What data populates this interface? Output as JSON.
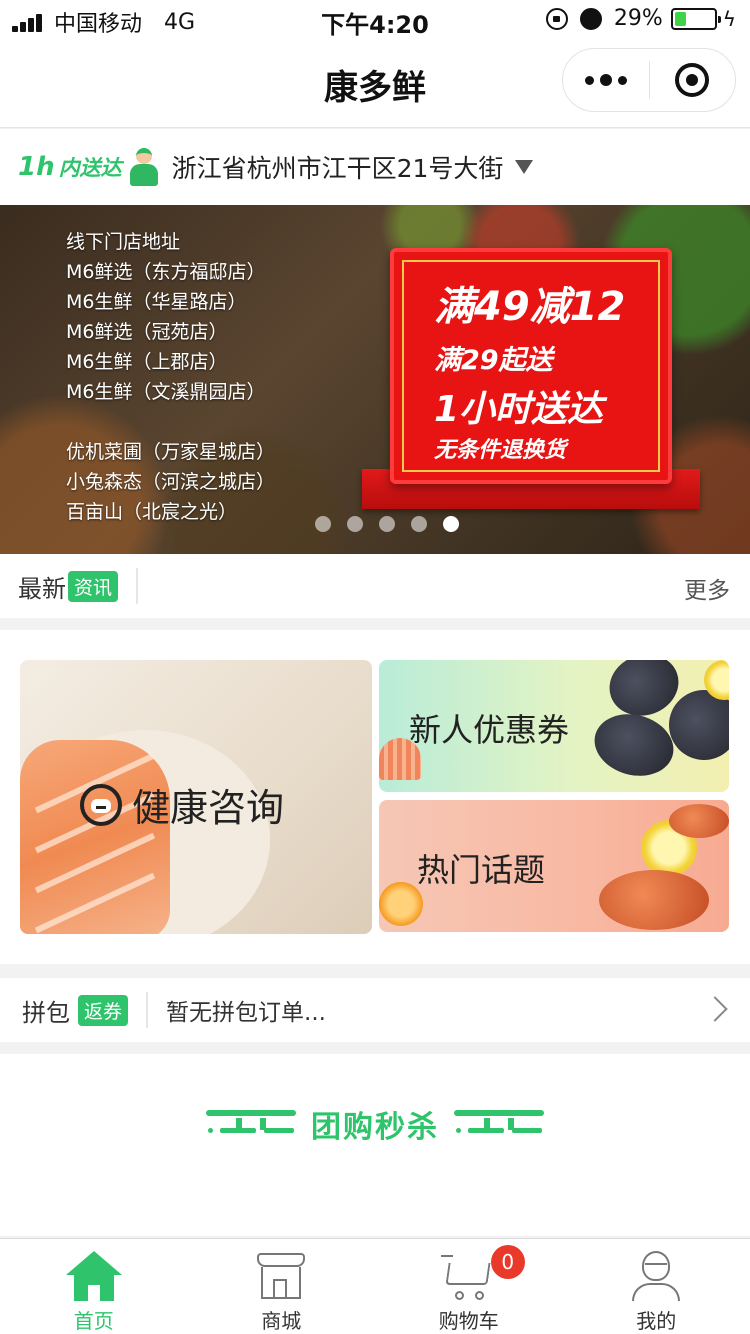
{
  "status_bar": {
    "carrier": "中国移动",
    "network": "4G",
    "time": "下午4:20",
    "battery": "29%",
    "battery_level": 0.29
  },
  "nav": {
    "title": "康多鲜",
    "more_icon": "more-dots-icon",
    "close_icon": "target-close-icon"
  },
  "address_bar": {
    "badge_speed": "1h",
    "badge_text": "内送达",
    "address": "浙江省杭州市江干区21号大街"
  },
  "banner": {
    "store_heading": "线下门店地址",
    "stores_group1": [
      "M6鲜选（东方福邸店）",
      "M6生鲜（华星路店）",
      "M6鲜选（冠苑店）",
      "M6生鲜（上郡店）",
      "M6生鲜（文溪鼎园店）"
    ],
    "stores_group2": [
      "优机菜圃（万家星城店）",
      "小兔森态（河滨之城店）",
      "百亩山（北宸之光）"
    ],
    "promo": {
      "line1": "满49减12",
      "line2": "满29起送",
      "line3": "1小时送达",
      "line4": "无条件退换货"
    },
    "dots_count": 5,
    "active_dot": 5
  },
  "news": {
    "label": "最新",
    "tag": "资讯",
    "more": "更多"
  },
  "tiles": {
    "health": "健康咨询",
    "coupon": "新人优惠券",
    "topic": "热门话题"
  },
  "group_buy": {
    "label": "拼包",
    "tag": "返券",
    "message": "暂无拼包订单..."
  },
  "flash_sale": {
    "title": "团购秒杀"
  },
  "tab_bar": {
    "items": [
      {
        "label": "首页",
        "icon": "home-icon",
        "active": true
      },
      {
        "label": "商城",
        "icon": "shop-icon",
        "active": false
      },
      {
        "label": "购物车",
        "icon": "cart-icon",
        "active": false,
        "badge": "0"
      },
      {
        "label": "我的",
        "icon": "profile-icon",
        "active": false
      }
    ]
  },
  "colors": {
    "accent": "#2fc46b",
    "promo_red": "#e81414",
    "badge_red": "#e8392b"
  }
}
